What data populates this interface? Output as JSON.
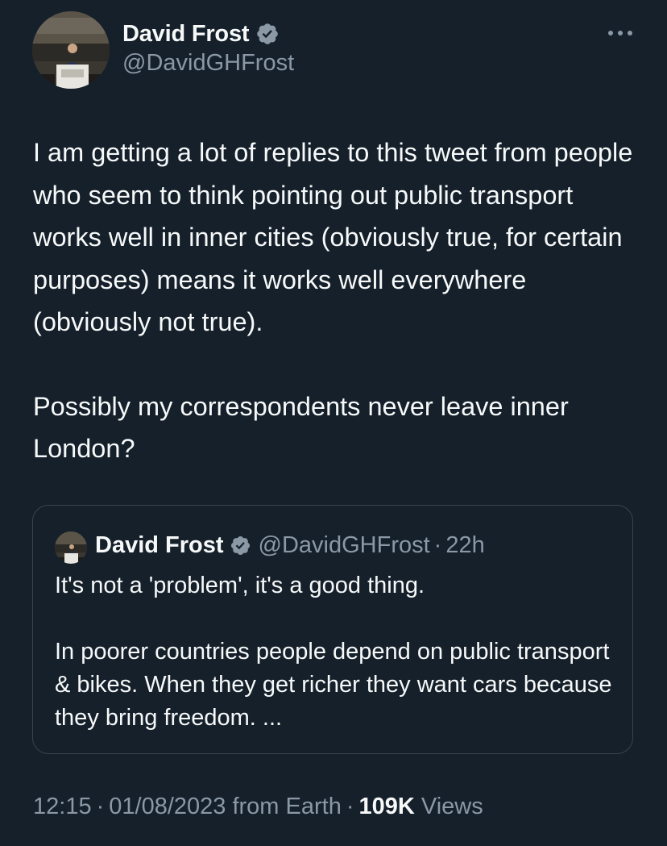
{
  "tweet": {
    "author": {
      "name": "David Frost",
      "handle": "@DavidGHFrost",
      "verified": true,
      "verified_color": "#8b98a5"
    },
    "paragraphs": [
      "I am getting a lot of replies to this tweet from people who seem to think pointing out public transport works well in inner cities (obviously true, for certain purposes) means it works well everywhere (obviously not true).",
      "Possibly my correspondents never leave inner London?"
    ],
    "quoted": {
      "author_name": "David Frost",
      "author_handle": "@DavidGHFrost",
      "separator": "·",
      "time": "22h",
      "paragraphs": [
        "It's not a 'problem', it's a good thing.",
        "In poorer countries people depend on public transport & bikes. When they get richer they want cars because they bring freedom. ..."
      ]
    },
    "meta": {
      "time": "12:15",
      "separator": "·",
      "date": "01/08/2023",
      "source": "from Earth",
      "views_count": "109K",
      "views_label": "Views"
    }
  },
  "colors": {
    "background": "#15202b",
    "text_primary": "#f7f9f9",
    "text_secondary": "#8b98a5",
    "border": "#38444d"
  },
  "icons": {
    "verified": "verified-badge-icon",
    "more": "more-options-icon"
  }
}
